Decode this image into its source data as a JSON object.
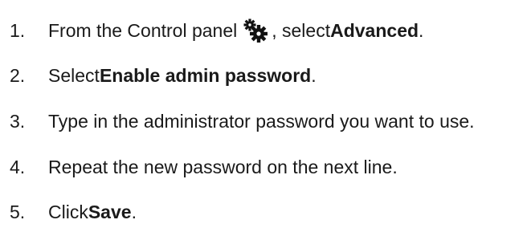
{
  "steps": [
    {
      "number": "1.",
      "text_before": "From the Control panel ",
      "icon": "gears-icon",
      "text_middle": ", select ",
      "bold": "Advanced",
      "text_after": "."
    },
    {
      "number": "2.",
      "text_before": "Select ",
      "bold": "Enable admin password",
      "text_after": "."
    },
    {
      "number": "3.",
      "text": "Type in the administrator password you want to use."
    },
    {
      "number": "4.",
      "text": "Repeat the new password on the next line."
    },
    {
      "number": "5.",
      "text_before": "Click ",
      "bold": "Save",
      "text_after": "."
    }
  ]
}
